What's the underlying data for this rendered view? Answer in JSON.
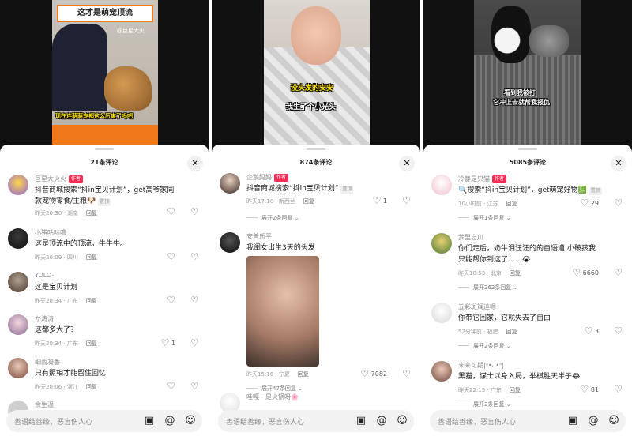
{
  "panels": [
    {
      "video": {
        "banner": "这才是萌宠顶流",
        "watermark": "@巨星大火",
        "caption": "现在连萌萌宠都这么厉害了吗吧"
      },
      "sheet": {
        "title": "21条评论"
      },
      "comments": [
        {
          "user": "巨星大火火",
          "author_tag": "作者",
          "text": "抖音商城搜索“抖in宝贝计划”，get高爷家同款宠物零食/主粮🐶",
          "tag": "置顶",
          "time": "昨天20:30",
          "location": "湖南",
          "reply": "回复",
          "likes": ""
        },
        {
          "user": "小猪咕咕噜",
          "text": "这是顶流中的顶流，牛牛牛。",
          "time": "昨天20:09",
          "location": "四川",
          "reply": "回复",
          "likes": ""
        },
        {
          "user": "YOLO-",
          "text": "这是宝贝计划",
          "time": "昨天20:34",
          "location": "广东",
          "reply": "回复",
          "likes": ""
        },
        {
          "user": "か涛涛",
          "text": "这都多大了？",
          "time": "昨天20:34",
          "location": "广东",
          "reply": "回复",
          "likes": "1"
        },
        {
          "user": "细雨凝香",
          "text": "只有照相才能留住回忆",
          "time": "昨天20:06",
          "location": "浙江",
          "reply": "回复",
          "likes": ""
        },
        {
          "user": "余生温"
        }
      ],
      "input": {
        "placeholder": "善语结善缘，恶言伤人心"
      }
    },
    {
      "video": {
        "caption_top": "没头发的安安",
        "caption_bottom": "我生了个小光头"
      },
      "sheet": {
        "title": "874条评论"
      },
      "comments": [
        {
          "user": "企鹅妈妈",
          "author_tag": "作者",
          "text": "抖音商城搜索“抖in宝贝计划”",
          "tag": "置顶",
          "time": "昨天17:18",
          "location": "新西兰",
          "reply": "回复",
          "likes": "1",
          "expand": "展开2条回复"
        },
        {
          "user": "安普乐平",
          "text": "我闺女出生3天的头发",
          "time": "昨天15:16",
          "location": "宁夏",
          "reply": "回复",
          "likes": "7082",
          "expand": "展开47条回复"
        },
        {
          "user": "哇嘎 - 是火锅呀🌸"
        }
      ],
      "input": {
        "placeholder": "善语结善缘，恶言伤人心"
      }
    },
    {
      "video": {
        "caption_line1": "看到我被打",
        "caption_line2": "它冲上去就帮我报仇"
      },
      "sheet": {
        "title": "5085条评论"
      },
      "comments": [
        {
          "user": "冷静是只猫",
          "author_tag": "作者",
          "text": "🔍搜索“抖in宝贝计划”，get萌宠好物💹",
          "tag": "置顶",
          "time": "10小时前",
          "location": "江苏",
          "reply": "回复",
          "likes": "29",
          "expand": "展开1条回复"
        },
        {
          "user": "梦里忘川",
          "text": "你们走后，奶牛泪汪汪的的自语道:小破孩我只能帮你到这了……😭",
          "time": "昨天18:53",
          "location": "北京",
          "reply": "回复",
          "likes": "6660",
          "expand": "展开262条回复"
        },
        {
          "user": "五彩斑斓迪嗯",
          "text": "你带它回家，它就失去了自由",
          "time": "52分钟前",
          "location": "福建",
          "reply": "回复",
          "likes": "3",
          "expand": "展开2条回复"
        },
        {
          "user": "未来可期|ᐢ•ᴗ•ᐢ|",
          "text": "黑猫，谋士以身入局，举棋胜天半子😂",
          "time": "昨天22:15",
          "location": "广东",
          "reply": "回复",
          "likes": "81",
          "expand": "展开2条回复"
        }
      ],
      "input": {
        "placeholder": "善语结善缘，恶言伤人心"
      }
    }
  ],
  "icons": {
    "close": "close-icon",
    "heart": "heart-icon",
    "dislike": "dislike-icon",
    "image": "image-icon",
    "at": "at-icon",
    "emoji": "emoji-icon"
  }
}
